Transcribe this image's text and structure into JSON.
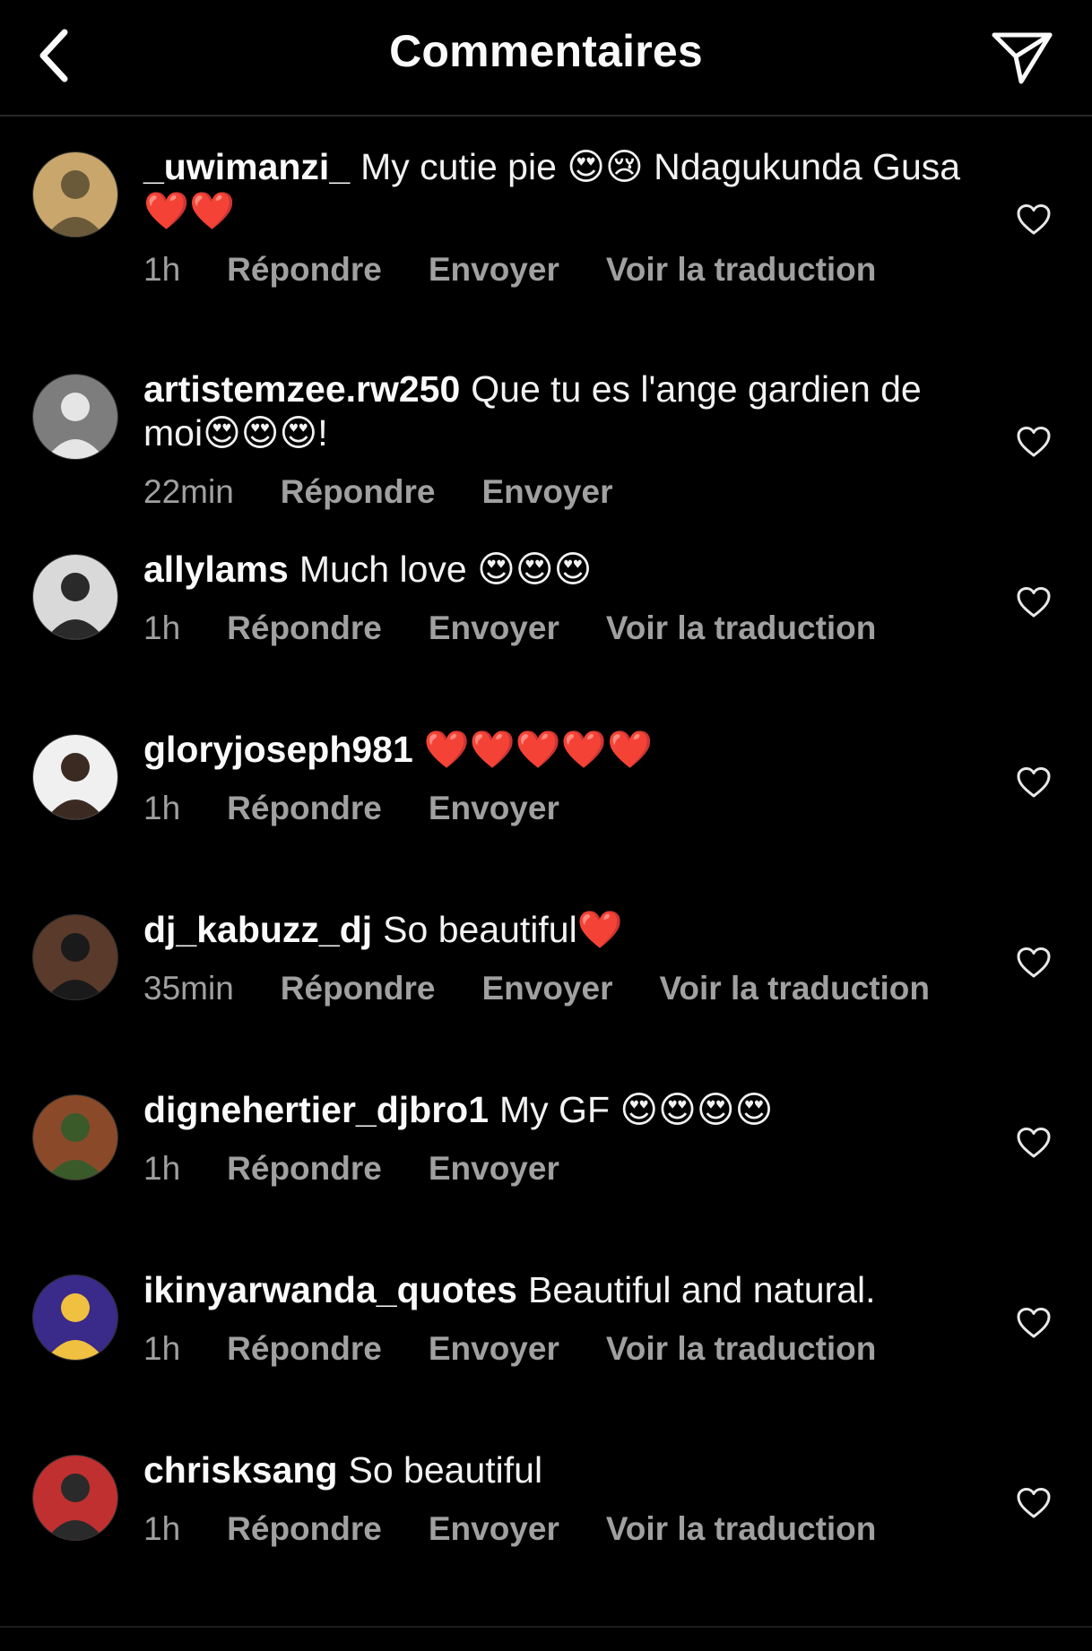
{
  "header": {
    "title": "Commentaires",
    "back_icon": "chevron-left-icon",
    "share_icon": "paper-plane-icon"
  },
  "actions": {
    "reply": "Répondre",
    "send": "Envoyer",
    "translate": "Voir la traduction"
  },
  "colors": {
    "background": "#000000",
    "text": "#f2f2f2",
    "meta": "#a0a0a0",
    "divider": "#262626"
  },
  "comments": [
    {
      "username": "_uwimanzi_",
      "text": "My cutie pie 😍😢 Ndagukunda Gusa ❤️❤️",
      "time": "1h",
      "show_translate": true
    },
    {
      "username": "artistemzee.rw250",
      "text": "Que tu es l'ange gardien de moi😍😍😍!",
      "time": "22min",
      "show_translate": false
    },
    {
      "username": "allylams",
      "text": "Much love 😍😍😍",
      "time": "1h",
      "show_translate": true
    },
    {
      "username": "gloryjoseph981",
      "text": "❤️❤️❤️❤️❤️",
      "time": "1h",
      "show_translate": false
    },
    {
      "username": "dj_kabuzz_dj",
      "text": "So beautiful❤️",
      "time": "35min",
      "show_translate": true
    },
    {
      "username": "dignehertier_djbro1",
      "text": "My GF 😍😍😍😍",
      "time": "1h",
      "show_translate": false
    },
    {
      "username": "ikinyarwanda_quotes",
      "text": "Beautiful and natural.",
      "time": "1h",
      "show_translate": true
    },
    {
      "username": "chrisksang",
      "text": "So beautiful",
      "time": "1h",
      "show_translate": true
    }
  ]
}
